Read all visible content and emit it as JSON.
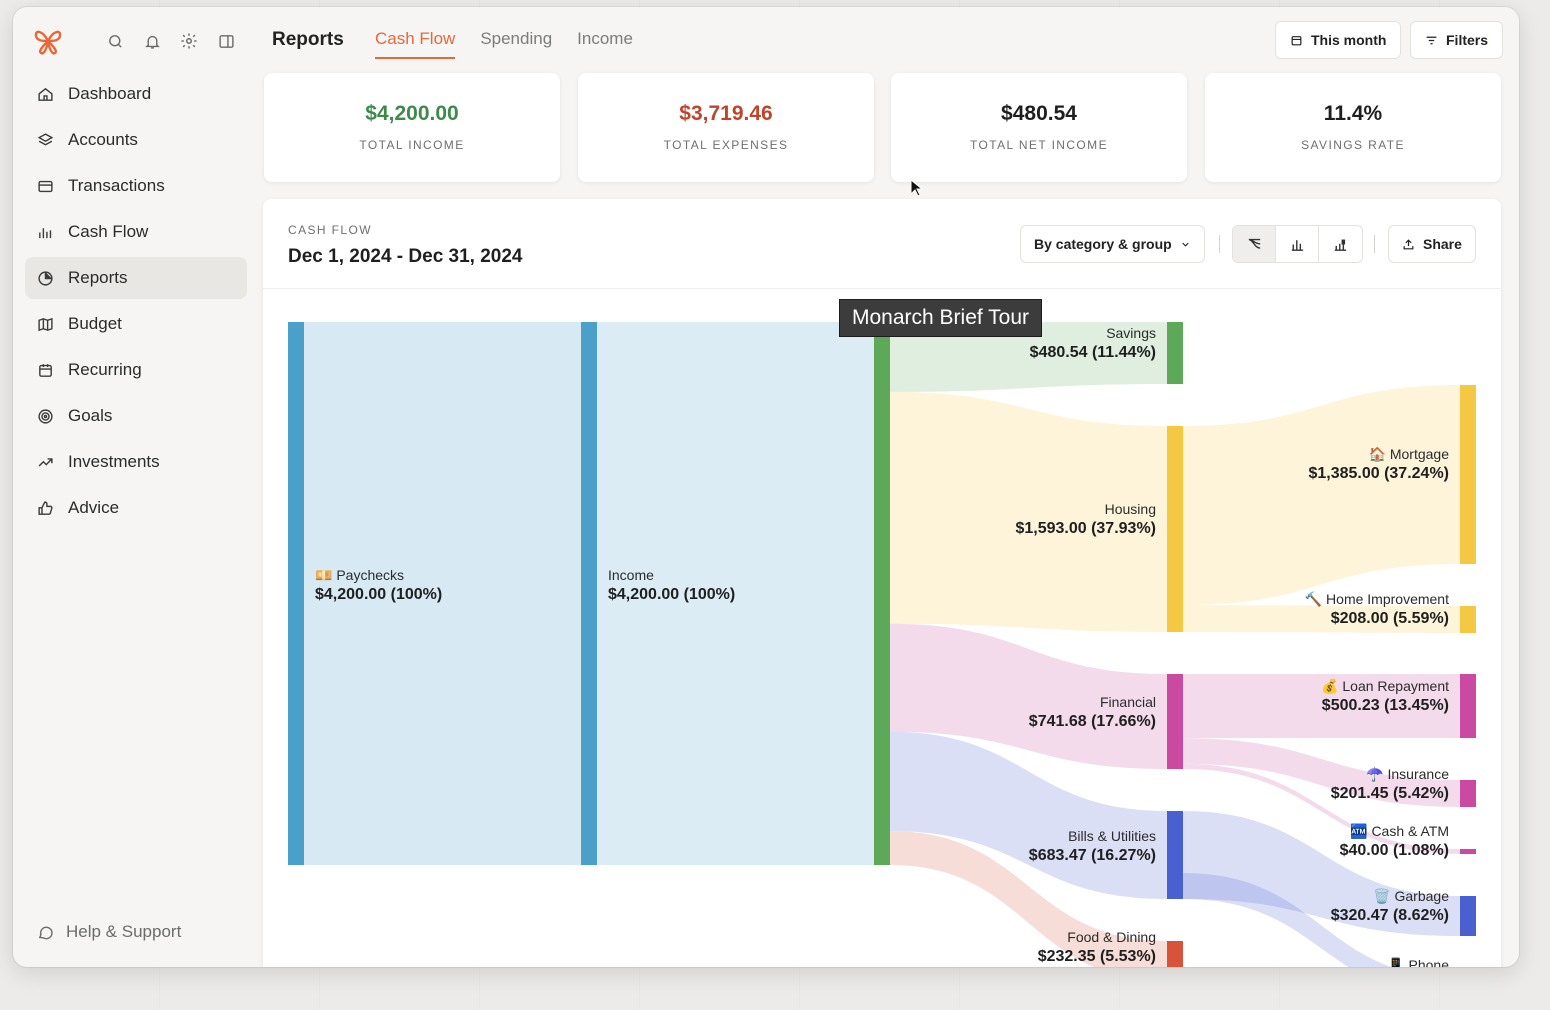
{
  "sidebar": {
    "nav": [
      {
        "label": "Dashboard",
        "icon": "home-icon"
      },
      {
        "label": "Accounts",
        "icon": "layers-icon"
      },
      {
        "label": "Transactions",
        "icon": "credit-card-icon"
      },
      {
        "label": "Cash Flow",
        "icon": "bar-chart-icon"
      },
      {
        "label": "Reports",
        "icon": "pie-chart-icon",
        "active": true
      },
      {
        "label": "Budget",
        "icon": "map-icon"
      },
      {
        "label": "Recurring",
        "icon": "calendar-icon"
      },
      {
        "label": "Goals",
        "icon": "target-icon"
      },
      {
        "label": "Investments",
        "icon": "trending-up-icon"
      },
      {
        "label": "Advice",
        "icon": "thumbs-up-icon"
      }
    ],
    "help": "Help & Support"
  },
  "header": {
    "title": "Reports",
    "tabs": [
      "Cash Flow",
      "Spending",
      "Income"
    ],
    "active_tab": "Cash Flow",
    "period_button": "This month",
    "filters_button": "Filters"
  },
  "stats": [
    {
      "value": "$4,200.00",
      "label": "TOTAL INCOME",
      "color": "#3d8a4a"
    },
    {
      "value": "$3,719.46",
      "label": "TOTAL EXPENSES",
      "color": "#c0442b"
    },
    {
      "value": "$480.54",
      "label": "TOTAL NET INCOME",
      "color": "#1f1f1f"
    },
    {
      "value": "11.4%",
      "label": "SAVINGS RATE",
      "color": "#1f1f1f"
    }
  ],
  "panel": {
    "kicker": "CASH FLOW",
    "date_range": "Dec 1, 2024 - Dec 31, 2024",
    "group_select": "By category & group",
    "share": "Share"
  },
  "tooltip": "Monarch Brief Tour",
  "chart_data": {
    "type": "sankey",
    "nodes": [
      {
        "id": "paychecks",
        "label": "💴 Paychecks",
        "value": "$4,200.00 (100%)",
        "color": "#4aa0c8"
      },
      {
        "id": "income",
        "label": "Income",
        "value": "$4,200.00 (100%)",
        "color": "#4aa0c8"
      },
      {
        "id": "total",
        "label": "",
        "value": "",
        "color": "#5ea85a"
      },
      {
        "id": "savings",
        "label": "Savings",
        "value": "$480.54 (11.44%)",
        "color": "#5ea85a"
      },
      {
        "id": "housing",
        "label": "Housing",
        "value": "$1,593.00 (37.93%)",
        "color": "#f4c842"
      },
      {
        "id": "financial",
        "label": "Financial",
        "value": "$741.68 (17.66%)",
        "color": "#c94aa0"
      },
      {
        "id": "bills",
        "label": "Bills & Utilities",
        "value": "$683.47 (16.27%)",
        "color": "#4a5fd0"
      },
      {
        "id": "food",
        "label": "Food & Dining",
        "value": "$232.35 (5.53%)",
        "color": "#d9533b"
      },
      {
        "id": "mortgage",
        "label": "🏠 Mortgage",
        "value": "$1,385.00 (37.24%)",
        "color": "#f4c842"
      },
      {
        "id": "homeimp",
        "label": "🔨 Home Improvement",
        "value": "$208.00 (5.59%)",
        "color": "#f4c842"
      },
      {
        "id": "loan",
        "label": "💰 Loan Repayment",
        "value": "$500.23 (13.45%)",
        "color": "#c94aa0"
      },
      {
        "id": "insurance",
        "label": "☂️ Insurance",
        "value": "$201.45 (5.42%)",
        "color": "#c94aa0"
      },
      {
        "id": "cash",
        "label": "🏧 Cash & ATM",
        "value": "$40.00 (1.08%)",
        "color": "#c94aa0"
      },
      {
        "id": "garbage",
        "label": "🗑️ Garbage",
        "value": "$320.47 (8.62%)",
        "color": "#4a5fd0"
      },
      {
        "id": "phone",
        "label": "📱 Phone",
        "value": "",
        "color": "#4a5fd0"
      }
    ],
    "links": [
      {
        "source": "paychecks",
        "target": "income",
        "value": 4200.0
      },
      {
        "source": "income",
        "target": "total",
        "value": 4200.0
      },
      {
        "source": "total",
        "target": "savings",
        "value": 480.54
      },
      {
        "source": "total",
        "target": "housing",
        "value": 1593.0
      },
      {
        "source": "total",
        "target": "financial",
        "value": 741.68
      },
      {
        "source": "total",
        "target": "bills",
        "value": 683.47
      },
      {
        "source": "total",
        "target": "food",
        "value": 232.35
      },
      {
        "source": "housing",
        "target": "mortgage",
        "value": 1385.0
      },
      {
        "source": "housing",
        "target": "homeimp",
        "value": 208.0
      },
      {
        "source": "financial",
        "target": "loan",
        "value": 500.23
      },
      {
        "source": "financial",
        "target": "insurance",
        "value": 201.45
      },
      {
        "source": "financial",
        "target": "cash",
        "value": 40.0
      },
      {
        "source": "bills",
        "target": "garbage",
        "value": 320.47
      }
    ]
  }
}
